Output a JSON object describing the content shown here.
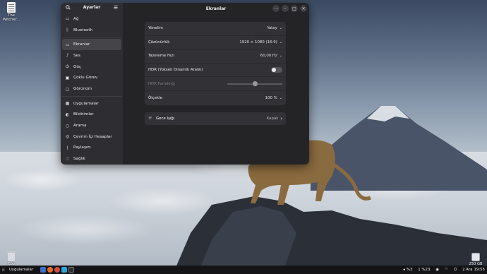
{
  "desktop": {
    "icons": [
      {
        "name": "The Witcher...",
        "icon": "document-icon"
      },
      {
        "name": "Çöp",
        "icon": "trash-icon"
      },
      {
        "name": "250 GB",
        "icon": "drive-icon"
      }
    ]
  },
  "sidebar": {
    "title": "Ayarlar",
    "items": [
      {
        "label": "Ağ",
        "icon": "network-icon"
      },
      {
        "label": "Bluetooth",
        "icon": "bluetooth-icon"
      },
      {
        "label": "Ekranlar",
        "icon": "display-icon",
        "active": true
      },
      {
        "label": "Ses",
        "icon": "sound-icon"
      },
      {
        "label": "Güç",
        "icon": "power-icon"
      },
      {
        "label": "Çoklu Görev",
        "icon": "multitask-icon"
      },
      {
        "label": "Görünüm",
        "icon": "appearance-icon"
      },
      {
        "label": "Uygulamalar",
        "icon": "apps-icon"
      },
      {
        "label": "Bildirimler",
        "icon": "bell-icon"
      },
      {
        "label": "Arama",
        "icon": "search-icon"
      },
      {
        "label": "Çevrim İçi Hesaplar",
        "icon": "online-accounts-icon"
      },
      {
        "label": "Paylaşım",
        "icon": "share-icon"
      },
      {
        "label": "Sağlık",
        "icon": "health-icon"
      }
    ]
  },
  "main": {
    "title": "Ekranlar",
    "rows": [
      {
        "label": "Yönelim",
        "value": "Yatay"
      },
      {
        "label": "Çözünürlük",
        "value": "1920 × 1080 (16:9)"
      },
      {
        "label": "Tazeleme Hızı",
        "value": "60,00 Hz"
      },
      {
        "label": "HDR (Yüksek Dinamik Aralık)",
        "toggle": false
      },
      {
        "label": "HDR Parlaklığı",
        "slider": 0.5
      },
      {
        "label": "Ölçekle",
        "value": "100 %"
      }
    ],
    "night_light": {
      "label": "Gece Işığı",
      "value": "Kapalı"
    }
  },
  "taskbar": {
    "apps_label": "Uygulamalar",
    "tray": {
      "volume": "%3",
      "battery": "%23",
      "date": "2 Ara",
      "time": "19:55"
    }
  }
}
